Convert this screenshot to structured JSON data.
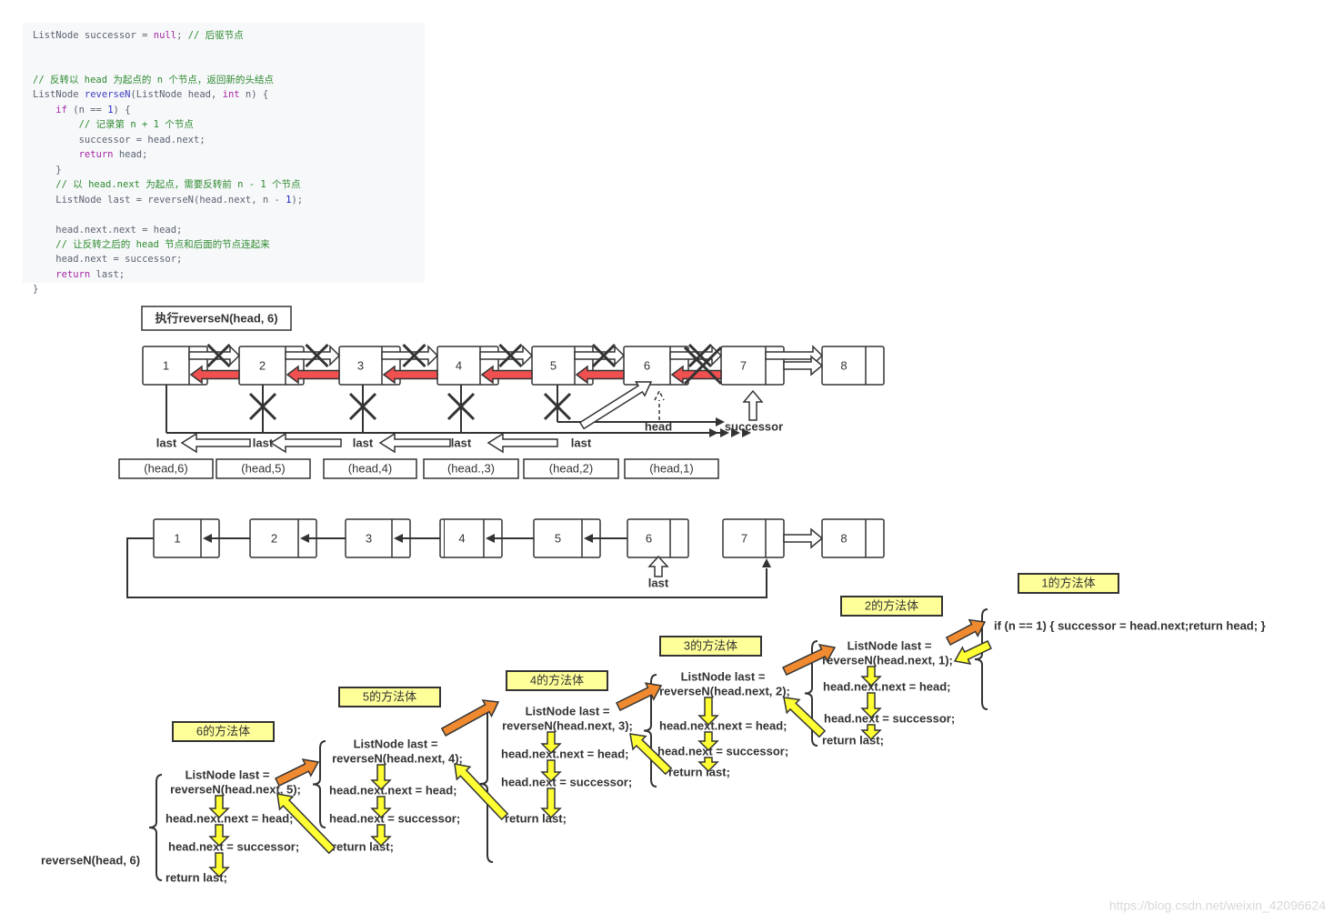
{
  "code": {
    "lines": [
      [
        [
          "ListNode successor = ",
          "pl"
        ],
        [
          "null",
          "kw"
        ],
        [
          "; ",
          "pl"
        ],
        [
          "// 后驱节点",
          "cm"
        ]
      ],
      [],
      [
        [
          "// 反转以 head 为起点的 n 个节点，返回新的头结点",
          "cm"
        ]
      ],
      [
        [
          "ListNode ",
          "pl"
        ],
        [
          "reverseN",
          "fn"
        ],
        [
          "(ListNode head, ",
          "pl"
        ],
        [
          "int",
          "kw"
        ],
        [
          " n) {",
          "pl"
        ]
      ],
      [
        [
          "    ",
          "pl"
        ],
        [
          "if",
          "kw"
        ],
        [
          " (n == ",
          "pl"
        ],
        [
          "1",
          "num"
        ],
        [
          ") {",
          "pl"
        ]
      ],
      [
        [
          "        // 记录第 n + 1 个节点",
          "cm"
        ]
      ],
      [
        [
          "        successor = head.next;",
          "pl"
        ]
      ],
      [
        [
          "        ",
          "pl"
        ],
        [
          "return",
          "kw"
        ],
        [
          " head;",
          "pl"
        ]
      ],
      [
        [
          "    }",
          "pl"
        ]
      ],
      [
        [
          "    // 以 head.next 为起点，需要反转前 n - 1 个节点",
          "cm"
        ]
      ],
      [
        [
          "    ListNode last = reverseN(head.next, n - ",
          "pl"
        ],
        [
          "1",
          "num"
        ],
        [
          ");",
          "pl"
        ]
      ],
      [],
      [
        [
          "    head.next.next = head;",
          "pl"
        ]
      ],
      [
        [
          "    // 让反转之后的 head 节点和后面的节点连起来",
          "cm"
        ]
      ],
      [
        [
          "    head.next = successor;",
          "pl"
        ]
      ],
      [
        [
          "    ",
          "pl"
        ],
        [
          "return",
          "kw"
        ],
        [
          " last;",
          "pl"
        ]
      ],
      [
        [
          "}",
          "pl"
        ]
      ]
    ]
  },
  "diagram1": {
    "title": "执行reverseN(head, 6)",
    "nodes": [
      "1",
      "2",
      "3",
      "4",
      "5",
      "6",
      "7",
      "8"
    ],
    "last_labels": [
      "last",
      "last",
      "last",
      "last",
      "last"
    ],
    "head_label": "head",
    "successor_label": "successor",
    "calls": [
      "(head,6)",
      "(head,5)",
      "(head,4)",
      "(head.,3)",
      "(head,2)",
      "(head,1)"
    ]
  },
  "diagram2": {
    "nodes": [
      "1",
      "2",
      "3",
      "4",
      "5",
      "6",
      "7",
      "8"
    ],
    "last_label": "last"
  },
  "methods": {
    "caller": "reverseN(head, 6)",
    "bodies": [
      {
        "title": "6的方法体",
        "lines": [
          "ListNode last =",
          "reverseN(head.next, 5);",
          "head.next.next = head;",
          "head.next = successor;",
          "return last;"
        ]
      },
      {
        "title": "5的方法体",
        "lines": [
          "ListNode last =",
          "reverseN(head.next, 4);",
          "head.next.next = head;",
          "head.next = successor;",
          "return last;"
        ]
      },
      {
        "title": "4的方法体",
        "lines": [
          "ListNode last =",
          "reverseN(head.next, 3);",
          "head.next.next = head;",
          "head.next = successor;",
          "return last;"
        ]
      },
      {
        "title": "3的方法体",
        "lines": [
          "ListNode last =",
          "reverseN(head.next, 2);",
          "head.next.next = head;",
          "head.next = successor;",
          "return last;"
        ]
      },
      {
        "title": "2的方法体",
        "lines": [
          "ListNode last =",
          "reverseN(head.next, 1);",
          "head.next.next = head;",
          "head.next = successor;",
          "return last;"
        ]
      },
      {
        "title": "1的方法体",
        "lines": [
          "if (n == 1) {  successor = head.next;return head; }"
        ]
      }
    ]
  },
  "watermark": "https://blog.csdn.net/weixin_42096624",
  "colors": {
    "title_box": "#ffff99",
    "red_arrow": "#f05050",
    "orange_arrow": "#f08a30",
    "yellow_arrow": "#ffff33",
    "line": "#333333",
    "code_bg": "#f6f8fa"
  }
}
